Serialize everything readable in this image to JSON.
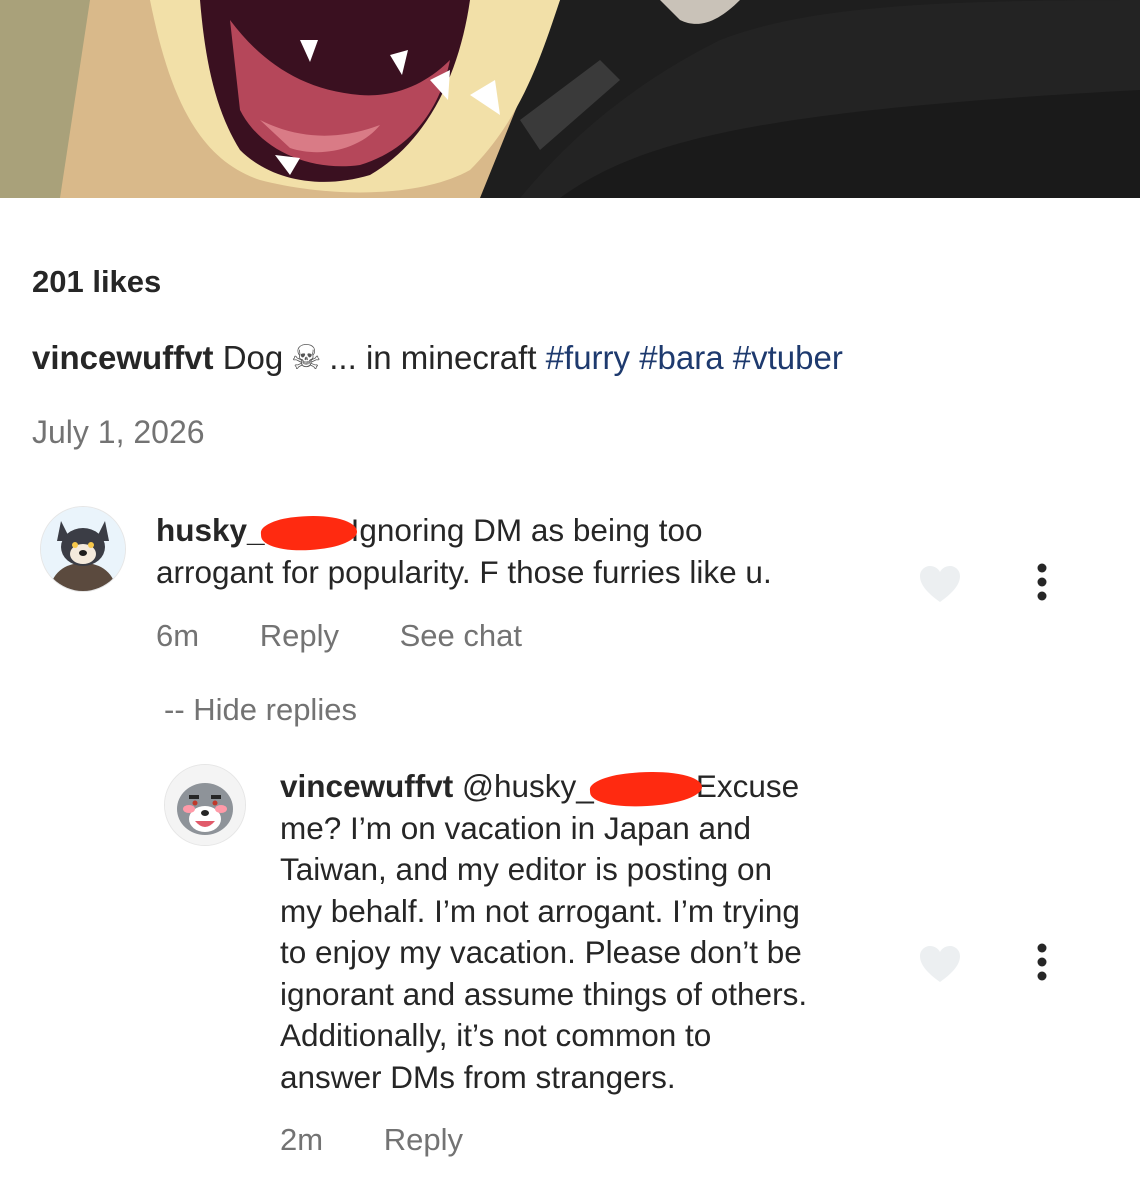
{
  "post": {
    "likes": "201 likes",
    "caption": {
      "username": "vincewuffvt",
      "text_before": "Dog",
      "emoji_icon": "skull-crossbones-icon",
      "text_after": "... in minecraft",
      "hashtags": [
        "#furry",
        "#bara",
        "#vtuber"
      ]
    },
    "date": "July 1, 2026"
  },
  "comments": [
    {
      "username": "husky_",
      "text_line1": "Ignoring DM as being too",
      "text_rest": "arrogant for popularity. F those furries like u.",
      "time": "6m",
      "reply_label": "Reply",
      "see_chat_label": "See chat",
      "hide_replies_label": "-- Hide replies"
    }
  ],
  "replies": [
    {
      "username": "vincewuffvt",
      "mention": "@husky_",
      "text_first": "Excuse",
      "lines": [
        "me? I’m on vacation in Japan and",
        "Taiwan, and my editor is posting on",
        "my behalf. I’m not arrogant. I’m trying",
        "to enjoy my vacation. Please don’t be",
        "ignorant and assume things of others.",
        "Additionally, it’s not common to",
        "answer DMs from strangers."
      ],
      "time": "2m",
      "reply_label": "Reply"
    }
  ],
  "colors": {
    "hashtag": "#1e3a6e",
    "secondary_text": "#737373",
    "redaction": "#ff2a10"
  }
}
